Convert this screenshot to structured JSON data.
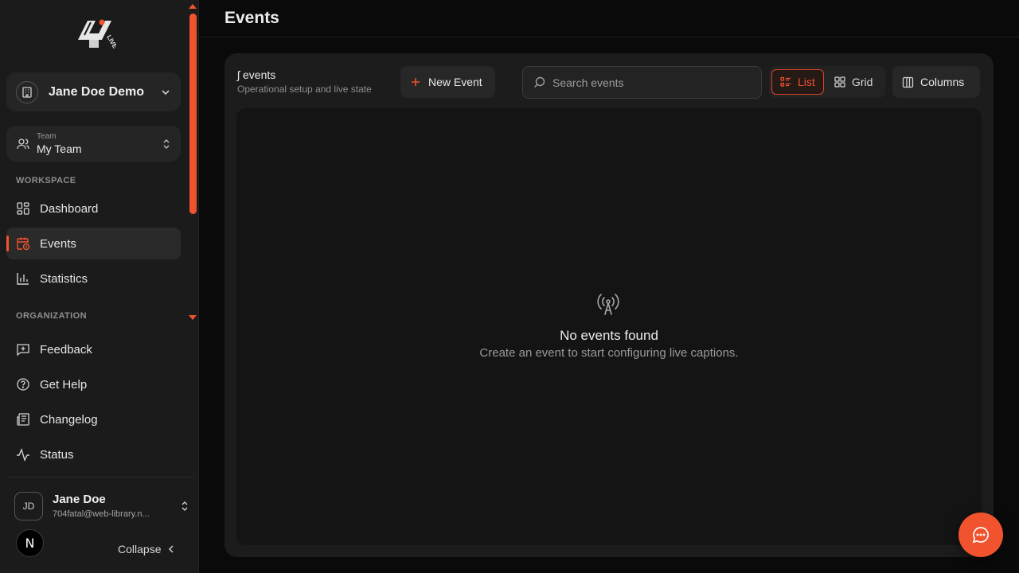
{
  "accent_color": "#f0532d",
  "sidebar": {
    "org": {
      "name": "Jane Doe Demo"
    },
    "team": {
      "caption": "Team",
      "name": "My Team"
    },
    "sections": {
      "workspace": "WORKSPACE",
      "organization": "ORGANIZATION"
    },
    "workspace_items": [
      {
        "label": "Dashboard",
        "icon": "dashboard-icon"
      },
      {
        "label": "Events",
        "icon": "calendar-clock-icon",
        "active": true
      },
      {
        "label": "Statistics",
        "icon": "bar-chart-icon"
      }
    ],
    "organization_items": [
      {
        "label": "Feedback",
        "icon": "message-plus-icon"
      },
      {
        "label": "Get Help",
        "icon": "help-circle-icon"
      },
      {
        "label": "Changelog",
        "icon": "newspaper-icon"
      },
      {
        "label": "Status",
        "icon": "activity-icon"
      }
    ],
    "user": {
      "initials": "JD",
      "name": "Jane Doe",
      "email": "704fatal@web-library.n..."
    },
    "n_badge": "N",
    "collapse_label": "Collapse"
  },
  "header": {
    "title": "Events"
  },
  "toolbar": {
    "count_label": "ʃ events",
    "subtitle": "Operational setup and live state",
    "new_event_label": "New Event",
    "search_placeholder": "Search events",
    "view_list_label": "List",
    "view_grid_label": "Grid",
    "columns_label": "Columns"
  },
  "empty_state": {
    "title": "No events found",
    "subtitle": "Create an event to start configuring live captions."
  }
}
